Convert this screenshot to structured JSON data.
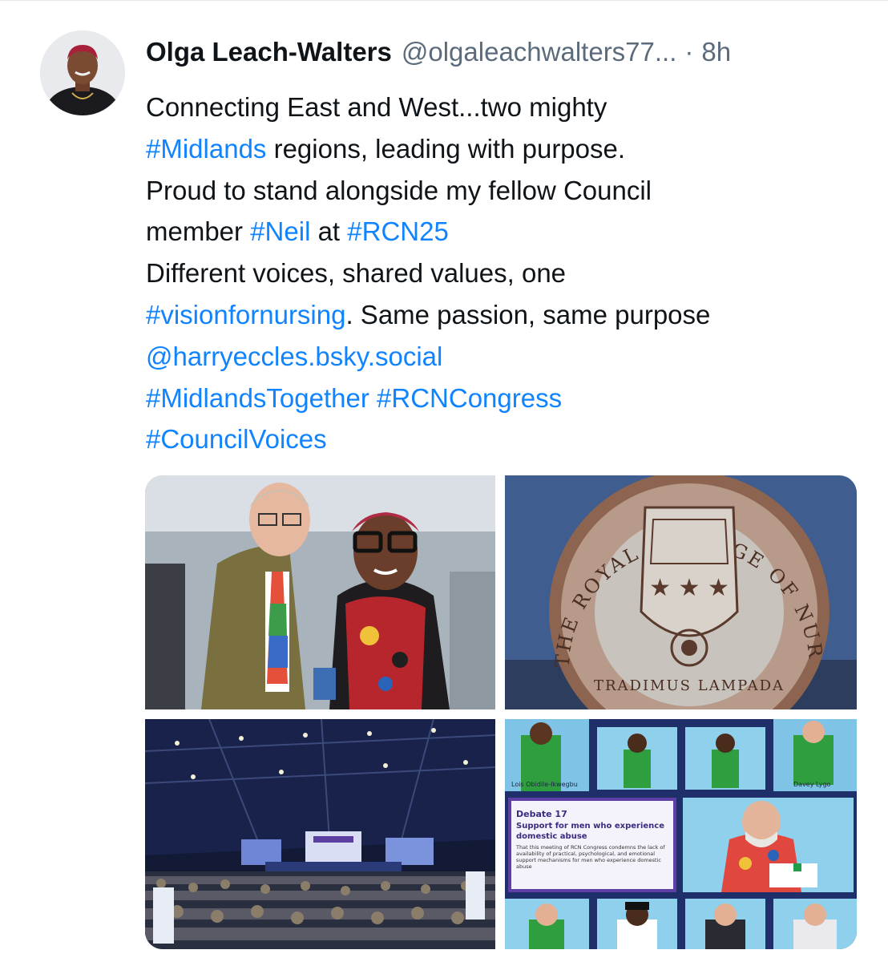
{
  "post": {
    "author": {
      "display_name": "Olga Leach-Walters",
      "handle": "@olgaleachwalters77...",
      "separator": "·",
      "time": "8h"
    },
    "text": {
      "l1": "Connecting East and West...two mighty",
      "l2_tag": "#Midlands",
      "l2_rest": " regions, leading with purpose.",
      "l3": "Proud to stand alongside my fellow Council",
      "l4_a": "member ",
      "l4_tag1": "#Neil",
      "l4_b": " at ",
      "l4_tag2": "#RCN25",
      "l5": "Different voices, shared values, one",
      "l6_tag": "#visionfornursing",
      "l6_rest": ". Same passion, same purpose",
      "l7_mention": "@harryeccles.bsky.social",
      "l8_tag1": "#MidlandsTogether",
      "l8_tag2": "#RCNCongress",
      "l9_tag": "#CouncilVoices"
    },
    "images": {
      "seal_text": "THE ROYAL COLLEGE OF NURSING OF THE UNITED KINGDOM",
      "seal_motto": "TRADIMUS LAMPADA",
      "screen_names": [
        "Lois Obidile-Ikwegbu",
        "Davey Lygo"
      ],
      "slide_title": "Debate 17",
      "slide_subtitle_l1": "Support for men who experience",
      "slide_subtitle_l2": "domestic abuse",
      "slide_body": "That this meeting of RCN Congress condemns the lack of availability of practical, psychological, and emotional support mechanisms for men who experience domestic abuse"
    }
  },
  "colors": {
    "link": "#1083fe",
    "muted": "#5b6b7c",
    "text": "#0f1419"
  }
}
